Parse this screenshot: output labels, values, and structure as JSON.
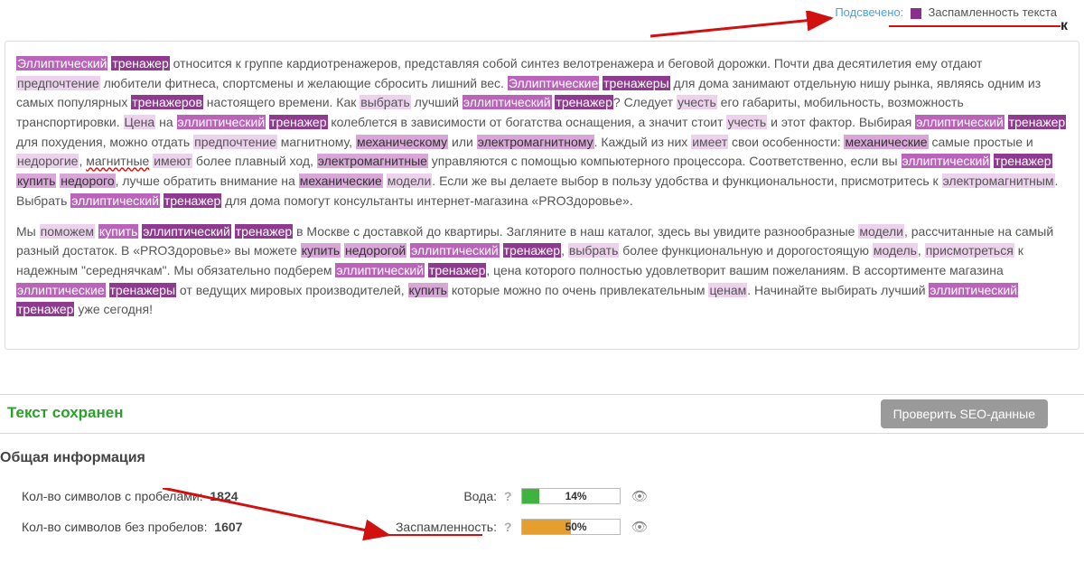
{
  "legend": {
    "link": "Подсвечено:",
    "label": "Заспамленность текста"
  },
  "corner_letter": "к",
  "paragraphs": {
    "p1": {
      "t01": "Эллиптический",
      "t02": "тренажер",
      "t03": " относится к группе кардиотренажеров, представляя собой синтез велотренажера и беговой дорожки. Почти два десятилетия ему отдают ",
      "t04": "предпочтение",
      "t05": " любители фитнеса, спортсмены и желающие сбросить лишний вес. ",
      "t06": "Эллиптические",
      "t07": "тренажеры",
      "t08": " для дома занимают отдельную нишу рынка, являясь одним из самых популярных ",
      "t09": "тренажеров",
      "t10": " настоящего времени. Как ",
      "t11": "выбрать",
      "t12": " лучший ",
      "t13": "эллиптический",
      "t14": "тренажер",
      "t15": "? Следует ",
      "t16": "учесть",
      "t17": " его габариты, мобильность, возможность транспортировки. ",
      "t18": "Цена",
      "t19": " на ",
      "t20": "эллиптический",
      "t21": "тренажер",
      "t22": " колеблется в зависимости от богатства оснащения, а значит стоит ",
      "t23": "учесть",
      "t24": " и этот фактор. Выбирая ",
      "t25": "эллиптический",
      "t26": "тренажер",
      "t27": " для похудения, можно отдать ",
      "t28": "предпочтение",
      "t29": " магнитному, ",
      "t30": "механическому",
      "t31": " или ",
      "t32": "электромагнитному",
      "t33": ". Каждый из них ",
      "t34": "имеет",
      "t35": " свои особенности: ",
      "t36": "механические",
      "t37": " самые простые и ",
      "t38": "недорогие",
      "t39": ", ",
      "t40": "магнитные",
      "t41": " ",
      "t42": "имеют",
      "t43": " более плавный ход, ",
      "t44": "электромагнитные",
      "t45": " управляются с помощью компьютерного процессора. Соответственно, если вы ",
      "t46": "эллиптический",
      "t47": "тренажер",
      "t48": "купить",
      "t49": "недорого",
      "t50": ", лучше обратить внимание на ",
      "t51": "механические",
      "t52": "модели",
      "t53": ". Если же вы делаете выбор в пользу удобства и функциональности, присмотритесь к ",
      "t54": "электромагнитным",
      "t55": ". Выбрать ",
      "t56": "эллиптический",
      "t57": "тренажер",
      "t58": " для дома помогут консультанты интернет-магазина «PROЗдоровье»."
    },
    "p2": {
      "s01": "Мы ",
      "s02": "поможем",
      "s03": "купить",
      "s04": "эллиптический",
      "s05": "тренажер",
      "s06": " в Москве с доставкой до квартиры. Загляните в наш каталог, здесь вы увидите разнообразные ",
      "s07": "модели",
      "s08": ", рассчитанные на самый разный достаток. В «PROЗдоровье» вы можете ",
      "s09": "купить",
      "s10": "недорогой",
      "s11": "эллиптический",
      "s12": "тренажер",
      "s13": ", ",
      "s14": "выбрать",
      "s15": " более функциональную и дорогостоящую ",
      "s16": "модель",
      "s17": ", ",
      "s18": "присмотреться",
      "s19": " к надежным \"середнячкам\". Мы обязательно подберем ",
      "s20": "эллиптический",
      "s21": "тренажер",
      "s22": ", цена которого полностью удовлетворит вашим пожеланиям. В ассортименте магазина ",
      "s23": "эллиптические",
      "s24": "тренажеры",
      "s25": " от ведущих мировых производителей, ",
      "s26": "купить",
      "s27": " которые можно по очень привлекательным ",
      "s28": "ценам",
      "s29": ". Начинайте выбирать лучший ",
      "s30": "эллиптический",
      "s31": "тренажер",
      "s32": " уже сегодня!"
    }
  },
  "saved": "Текст сохранен",
  "seo_button": "Проверить SEO-данные",
  "info_heading": "Общая информация",
  "metrics": {
    "chars_with_spaces_label": "Кол-во символов с пробелами:",
    "chars_with_spaces_value": "1824",
    "chars_without_spaces_label": "Кол-во символов без пробелов:",
    "chars_without_spaces_value": "1607",
    "water_label": "Вода:",
    "water_value": "14%",
    "spam_label": "Заспамленность:",
    "spam_value": "50%",
    "help": "?",
    "eye": "👁"
  },
  "underline_targets": {
    "top": "Заспамленность текста",
    "bottom": "Заспамленность"
  }
}
